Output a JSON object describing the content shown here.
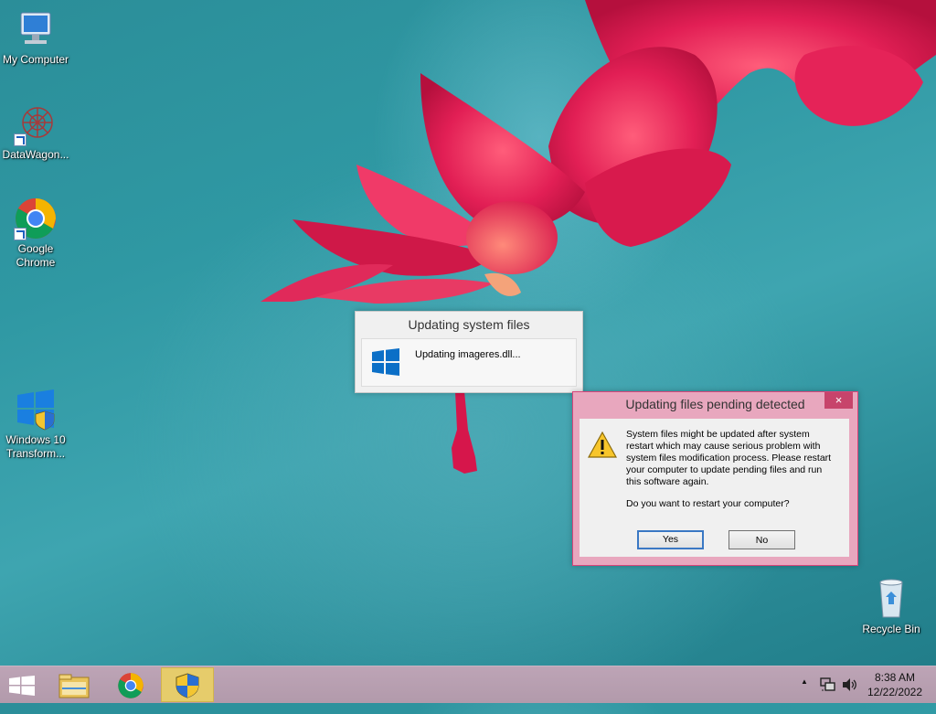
{
  "desktop": {
    "icons": [
      {
        "label": "My Computer"
      },
      {
        "label": "DataWagon..."
      },
      {
        "label": "Google Chrome"
      },
      {
        "label": "Windows 10 Transform..."
      },
      {
        "label": "Recycle Bin"
      }
    ]
  },
  "progress_window": {
    "title": "Updating system files",
    "status": "Updating imageres.dll..."
  },
  "dialog": {
    "title": "Updating files pending detected",
    "close_label": "×",
    "message": "System files might be updated after system restart which may cause serious problem with system files modification process. Please restart your computer to update pending files and run this software again.",
    "question": "Do you want to restart your computer?",
    "yes_label": "Yes",
    "no_label": "No",
    "icon": "warning-icon"
  },
  "taskbar": {
    "start": "start-icon",
    "apps": [
      "file-explorer-icon",
      "chrome-icon",
      "shield-app-icon"
    ],
    "tray": {
      "chevron": "▲",
      "time": "8:38 AM",
      "date": "12/22/2022"
    }
  },
  "colors": {
    "dialog_border": "#d9457a",
    "dialog_frame": "#e8a7be",
    "taskbar": "#b29aab",
    "active_task": "#e6cc6b"
  }
}
